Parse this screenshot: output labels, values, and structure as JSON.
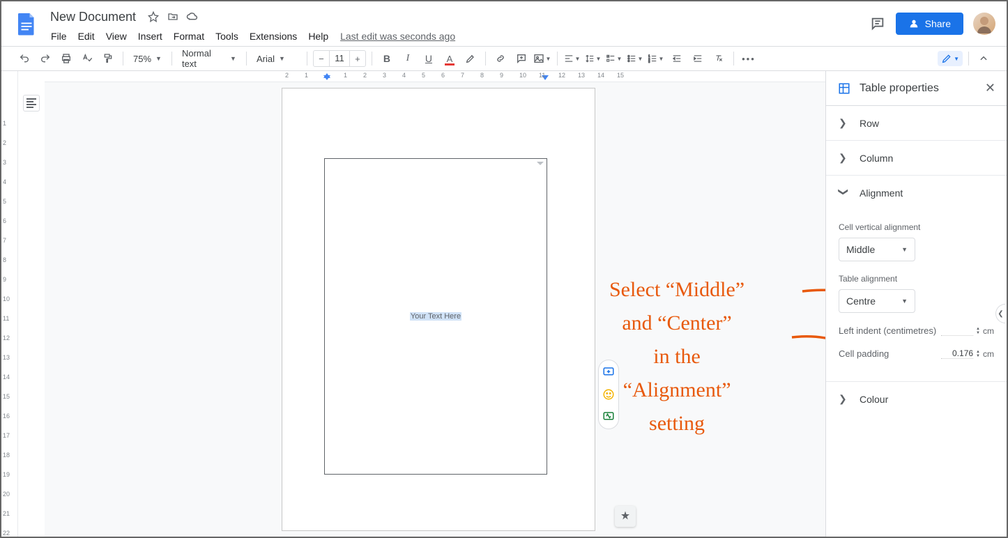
{
  "doc_title": "New Document",
  "menus": [
    "File",
    "Edit",
    "View",
    "Insert",
    "Format",
    "Tools",
    "Extensions",
    "Help"
  ],
  "last_edit": "Last edit was seconds ago",
  "share_label": "Share",
  "toolbar": {
    "zoom": "75%",
    "style": "Normal text",
    "font": "Arial",
    "font_size": "11"
  },
  "ruler_h": [
    "2",
    "1",
    "",
    "1",
    "2",
    "3",
    "4",
    "5",
    "6",
    "7",
    "8",
    "9",
    "10",
    "11",
    "12",
    "13",
    "14",
    "15"
  ],
  "ruler_v": [
    "",
    "1",
    "2",
    "3",
    "4",
    "5",
    "6",
    "7",
    "8",
    "9",
    "10",
    "11",
    "12",
    "13",
    "14",
    "15",
    "16",
    "17",
    "18",
    "19",
    "20",
    "21",
    "22"
  ],
  "cell_text": "Your Text Here",
  "panel": {
    "title": "Table properties",
    "row_label": "Row",
    "column_label": "Column",
    "alignment_label": "Alignment",
    "cell_valign_label": "Cell vertical alignment",
    "cell_valign_value": "Middle",
    "table_align_label": "Table alignment",
    "table_align_value": "Centre",
    "left_indent_label": "Left indent (centimetres)",
    "left_indent_unit": "cm",
    "padding_label": "Cell padding",
    "padding_value": "0.176",
    "padding_unit": "cm",
    "colour_label": "Colour"
  },
  "annotation": {
    "l1": "Select “Middle”",
    "l2": "and “Center”",
    "l3": "in the",
    "l4": "“Alignment”",
    "l5": "setting"
  }
}
